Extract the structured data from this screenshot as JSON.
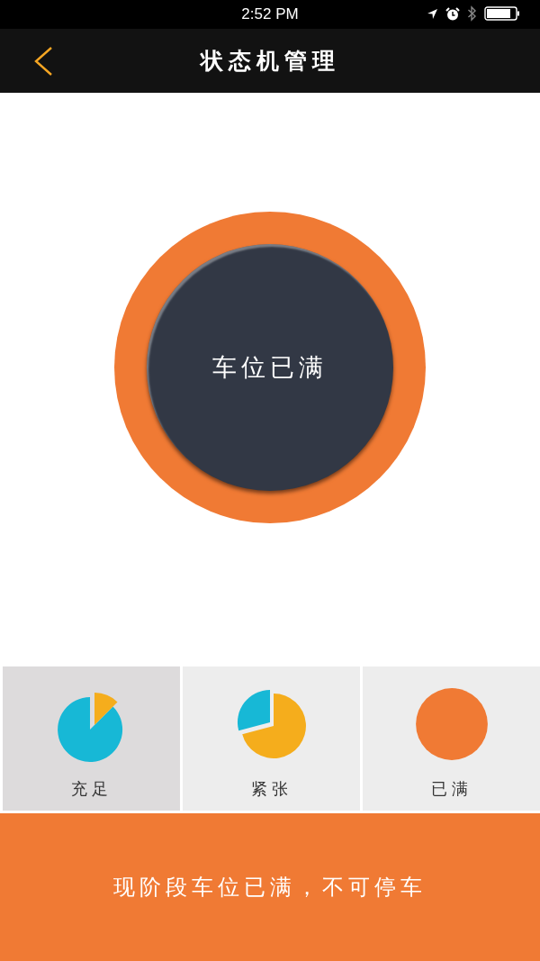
{
  "status_bar": {
    "time": "2:52 PM"
  },
  "nav": {
    "title": "状态机管理"
  },
  "status_button": {
    "label": "车位已满"
  },
  "tabs": [
    {
      "label": "充足",
      "kind": "ample",
      "selected": true
    },
    {
      "label": "紧张",
      "kind": "tight",
      "selected": false
    },
    {
      "label": "已满",
      "kind": "full",
      "selected": false
    }
  ],
  "notice": "现阶段车位已满，不可停车"
}
